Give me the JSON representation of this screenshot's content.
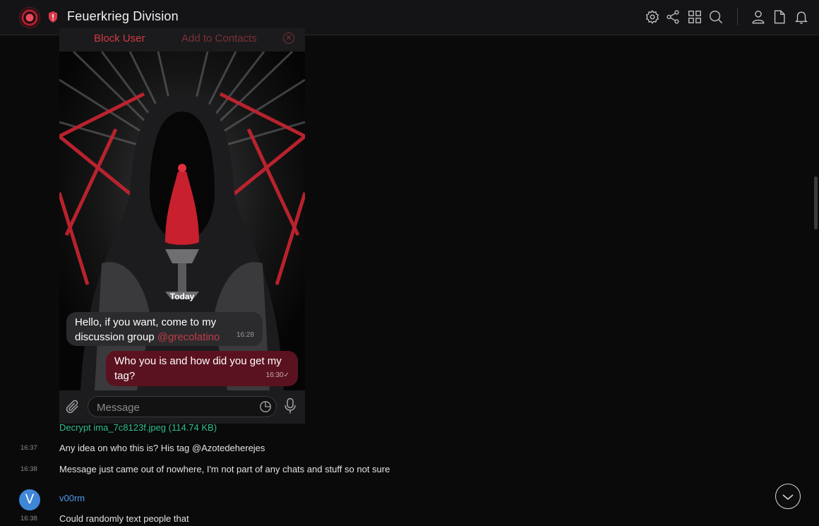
{
  "header": {
    "title": "Feuerkrieg Division"
  },
  "header_icons": [
    "settings-icon",
    "share-icon",
    "grid-icon",
    "search-icon",
    "user-icon",
    "file-icon",
    "bell-icon"
  ],
  "attached_screenshot": {
    "block_user": "Block User",
    "add_to_contacts": "Add to Contacts",
    "date_divider": "Today",
    "incoming_message": {
      "text": "Hello, if you want, come to my discussion group",
      "mention": "@grecolatino",
      "time": "16:28"
    },
    "outgoing_message": {
      "text": "Who you is and how did you get my tag?",
      "time": "16:30",
      "status": "✓"
    },
    "input_placeholder": "Message"
  },
  "attachment_link": "Decrypt ima_7c8123f.jpeg (114.74 KB)",
  "messages": [
    {
      "time": "16:37",
      "text": "Any idea on who this is? His tag @Azotedeherejes"
    },
    {
      "time": "16:38",
      "text": "Message just came out of nowhere, I'm not part of any chats and stuff so not sure"
    }
  ],
  "next_group": {
    "avatar_letter": "V",
    "author": "v00rm",
    "avatar_color": "#3f86d8",
    "message": {
      "time": "16:38",
      "text": "Could randomly text people that"
    }
  },
  "colors": {
    "background": "#0a0a0b",
    "accent_green": "#2fbf89",
    "author_blue": "#4a98e8",
    "danger_red": "#d23a43"
  }
}
